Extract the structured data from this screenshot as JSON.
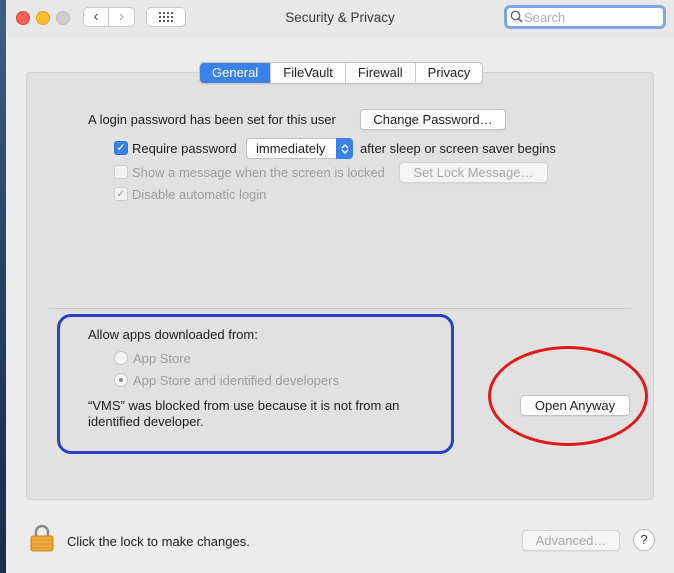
{
  "window": {
    "title": "Security & Privacy"
  },
  "search": {
    "placeholder": "Search",
    "value": ""
  },
  "tabs": [
    {
      "label": "General",
      "active": true
    },
    {
      "label": "FileVault",
      "active": false
    },
    {
      "label": "Firewall",
      "active": false
    },
    {
      "label": "Privacy",
      "active": false
    }
  ],
  "general": {
    "login_password_text": "A login password has been set for this user",
    "change_password_label": "Change Password…",
    "require_password": {
      "label": "Require password",
      "checked": true,
      "select_value": "immediately",
      "suffix": "after sleep or screen saver begins"
    },
    "show_message": {
      "label": "Show a message when the screen is locked",
      "checked": false,
      "button_label": "Set Lock Message…"
    },
    "disable_auto_login": {
      "label": "Disable automatic login",
      "checked": true
    }
  },
  "allow_apps": {
    "heading": "Allow apps downloaded from:",
    "options": [
      {
        "label": "App Store",
        "selected": false
      },
      {
        "label": "App Store and identified developers",
        "selected": true
      }
    ],
    "blocked_message_line1": "“VMS” was blocked from use because it is not from an",
    "blocked_message_line2": "identified developer.",
    "open_anyway_label": "Open Anyway"
  },
  "footer": {
    "lock_text": "Click the lock to make changes.",
    "advanced_label": "Advanced…",
    "help_label": "?"
  },
  "colors": {
    "accent": "#3b82e6",
    "annotation_blue": "#2d40c8",
    "annotation_red": "#e01919"
  }
}
